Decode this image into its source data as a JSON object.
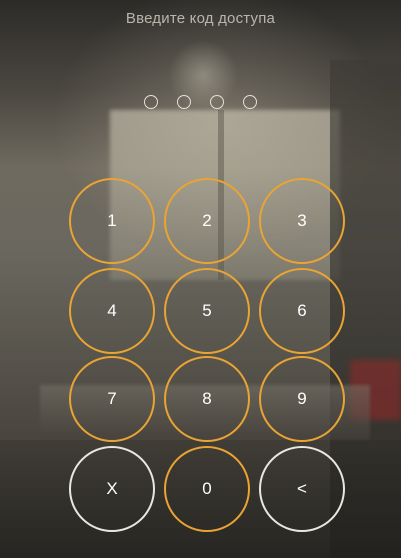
{
  "header": {
    "title": "Введите код доступа"
  },
  "pin": {
    "slots": 4,
    "filled": 0
  },
  "keypad": {
    "keys": [
      {
        "label": "1"
      },
      {
        "label": "2"
      },
      {
        "label": "3"
      },
      {
        "label": "4"
      },
      {
        "label": "5"
      },
      {
        "label": "6"
      },
      {
        "label": "7"
      },
      {
        "label": "8"
      },
      {
        "label": "9"
      },
      {
        "label": "X"
      },
      {
        "label": "0"
      },
      {
        "label": "<"
      }
    ]
  },
  "colors": {
    "digit_ring": "#e9a434",
    "action_ring": "#e9e7e2",
    "title_text": "#b9b5aa"
  }
}
